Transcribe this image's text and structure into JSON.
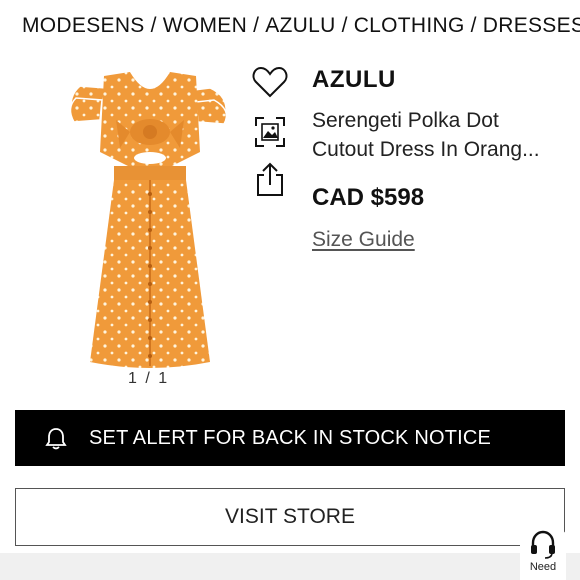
{
  "breadcrumb": [
    "MODESENS",
    "WOMEN",
    "AZULU",
    "CLOTHING",
    "DRESSES"
  ],
  "breadcrumb_separator": "/",
  "product": {
    "brand": "AZULU",
    "name_line1": "Serengeti Polka Dot",
    "name_line2": "Cutout Dress In Orang...",
    "price": "CAD $598",
    "size_guide": "Size Guide",
    "image_pager": "1 / 1",
    "image_color": "#F09A3A"
  },
  "actions": {
    "favorite_icon": "heart-icon",
    "visual_search_icon": "image-scan-icon",
    "share_icon": "share-icon"
  },
  "alert_button": {
    "label": "SET ALERT FOR BACK IN STOCK NOTICE",
    "icon": "bell-icon"
  },
  "visit_button": {
    "label": "VISIT STORE"
  },
  "help": {
    "label": "Need",
    "icon": "headset-icon"
  }
}
